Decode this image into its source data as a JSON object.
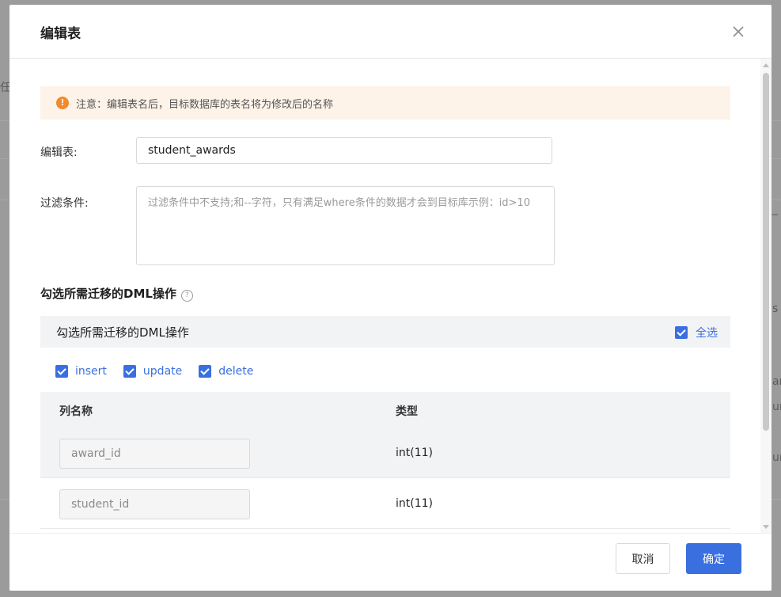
{
  "background": {
    "fragments": [
      "任",
      "_",
      "s",
      "ar",
      "ur",
      "ur"
    ]
  },
  "dialog": {
    "title": "编辑表",
    "close_icon": "close-icon"
  },
  "notice": {
    "icon": "warning-icon",
    "text": "注意：编辑表名后，目标数据库的表名将为修改后的名称"
  },
  "form": {
    "table_label": "编辑表:",
    "table_value": "student_awards",
    "filter_label": "过滤条件:",
    "filter_placeholder": "过滤条件中不支持;和--字符，只有满足where条件的数据才会到目标库示例：id>10"
  },
  "dml": {
    "section_title": "勾选所需迁移的DML操作",
    "help_icon": "help-icon",
    "panel_title": "勾选所需迁移的DML操作",
    "select_all_label": "全选",
    "operations": [
      {
        "label": "insert",
        "checked": true
      },
      {
        "label": "update",
        "checked": true
      },
      {
        "label": "delete",
        "checked": true
      }
    ]
  },
  "columns_table": {
    "headers": [
      "列名称",
      "类型"
    ],
    "rows": [
      {
        "name": "award_id",
        "type": "int(11)"
      },
      {
        "name": "student_id",
        "type": "int(11)"
      }
    ]
  },
  "footer": {
    "cancel_label": "取消",
    "ok_label": "确定"
  },
  "colors": {
    "primary": "#3a6fe0",
    "notice_bg": "#fdf3e8",
    "warning": "#f08a2c"
  }
}
